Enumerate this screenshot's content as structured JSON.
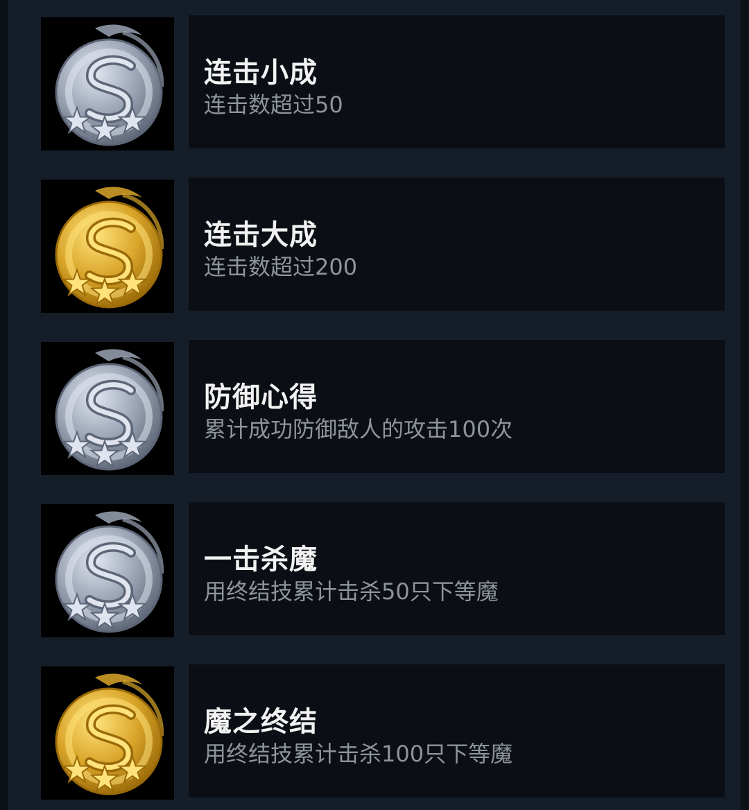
{
  "achievements": [
    {
      "title": "连击小成",
      "description": "连击数超过50",
      "badge": "silver-dragon-medal-icon",
      "tier": "silver"
    },
    {
      "title": "连击大成",
      "description": "连击数超过200",
      "badge": "gold-dragon-medal-icon",
      "tier": "gold"
    },
    {
      "title": "防御心得",
      "description": "累计成功防御敌人的攻击100次",
      "badge": "silver-dragon-medal-icon",
      "tier": "silver"
    },
    {
      "title": "一击杀魔",
      "description": "用终结技累计击杀50只下等魔",
      "badge": "silver-dragon-medal-icon",
      "tier": "silver"
    },
    {
      "title": "魔之终结",
      "description": "用终结技累计击杀100只下等魔",
      "badge": "gold-dragon-medal-icon",
      "tier": "gold"
    }
  ],
  "colors": {
    "panel_background": "#151e28",
    "card_background": "#0b0f15",
    "title_text": "#f2f2f2",
    "description_text": "#8e949b",
    "silver_light": "#dfe4ee",
    "silver_dark": "#5d6677",
    "gold_light": "#ffe27a",
    "gold_dark": "#9a6a08"
  }
}
